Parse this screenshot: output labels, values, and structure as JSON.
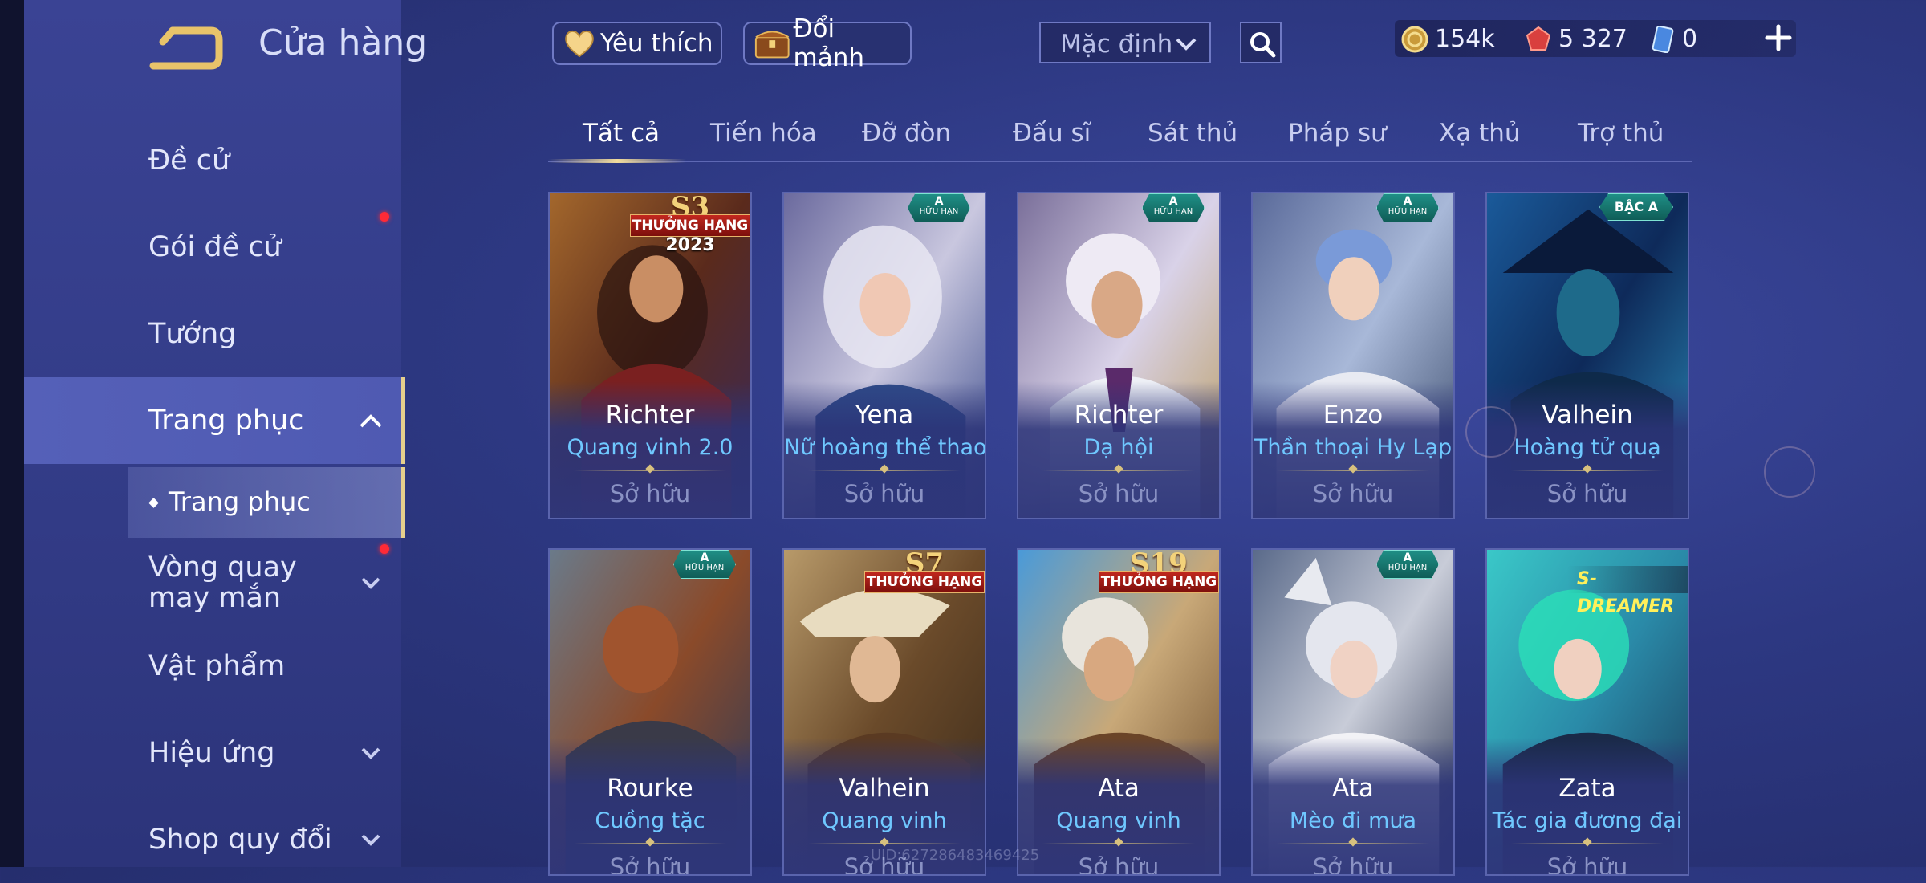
{
  "header": {
    "title": "Cửa hàng",
    "favorite_label": "Yêu thích",
    "exchange_label": "Đổi mảnh",
    "sort_value": "Mặc định"
  },
  "currency": {
    "gold": "154k",
    "vouchers": "5 327",
    "quan_huy": "0"
  },
  "sidebar": {
    "items": [
      {
        "label": "Đề cử"
      },
      {
        "label": "Gói đề cử"
      },
      {
        "label": "Tướng"
      },
      {
        "label": "Trang phục"
      },
      {
        "label": "Vòng quay may mắn"
      },
      {
        "label": "Vật phẩm"
      },
      {
        "label": "Hiệu ứng"
      },
      {
        "label": "Shop quy đổi"
      }
    ],
    "sub_item": "Trang phục"
  },
  "tabs": [
    "Tất cả",
    "Tiến hóa",
    "Đỡ đòn",
    "Đấu sĩ",
    "Sát thủ",
    "Pháp sư",
    "Xạ thủ",
    "Trợ thủ"
  ],
  "badges": {
    "a": "A",
    "huu_han": "HỮU HẠN",
    "bac_a": "BẬC A",
    "thuong_hang": "THƯỞNG HẠNG",
    "s_dreamer": "S-DREAMER"
  },
  "cards": [
    {
      "hero": "Richter",
      "skin": "Quang vinh 2.0",
      "status": "Sở hữu",
      "rank": "S3",
      "year": "2023"
    },
    {
      "hero": "Yena",
      "skin": "Nữ hoàng thể thao",
      "status": "Sở hữu"
    },
    {
      "hero": "Richter",
      "skin": "Dạ hội",
      "status": "Sở hữu"
    },
    {
      "hero": "Enzo",
      "skin": "Thần thoại Hy Lạp",
      "status": "Sở hữu"
    },
    {
      "hero": "Valhein",
      "skin": "Hoàng tử quạ",
      "status": "Sở hữu"
    },
    {
      "hero": "Rourke",
      "skin": "Cuồng tặc",
      "status": "Sở hữu"
    },
    {
      "hero": "Valhein",
      "skin": "Quang vinh",
      "status": "Sở hữu",
      "rank": "S7"
    },
    {
      "hero": "Ata",
      "skin": "Quang vinh",
      "status": "Sở hữu",
      "rank": "S19"
    },
    {
      "hero": "Ata",
      "skin": "Mèo đi mưa",
      "status": "Sở hữu"
    },
    {
      "hero": "Zata",
      "skin": "Tác gia đương đại",
      "status": "Sở hữu"
    }
  ],
  "footer": {
    "uid": "UID:6272864834694­25"
  },
  "colors": {
    "accent_gold": "#e6cf8c",
    "skin_name_blue": "#6fc8ff",
    "badge_red": "#c2281f",
    "notification_red": "#ff2a36"
  }
}
